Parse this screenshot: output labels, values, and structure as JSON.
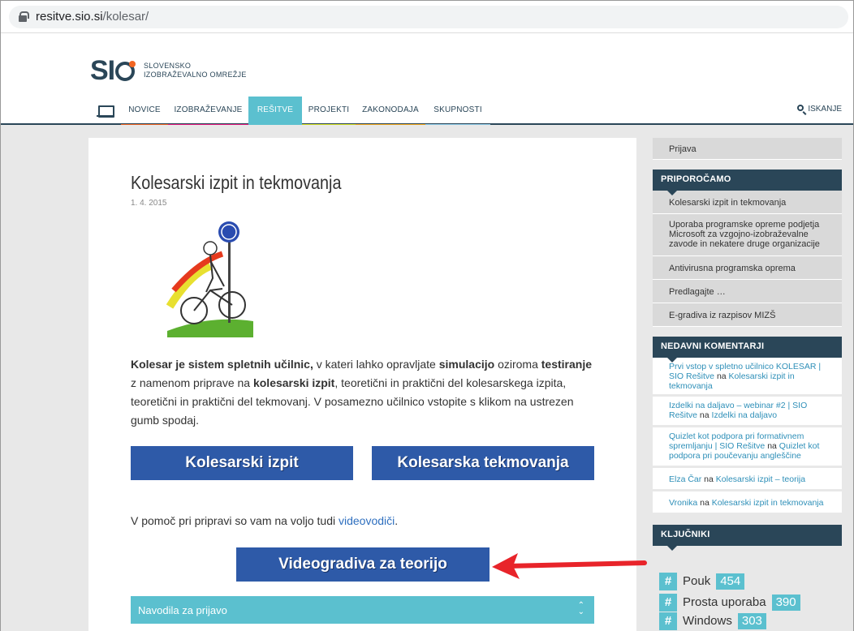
{
  "browser": {
    "url_host": "resitve.sio.si",
    "url_path": "/kolesar/"
  },
  "logo": {
    "mark": "SI",
    "line1": "SLOVENSKO",
    "line2": "IZOBRAŽEVALNO OMREŽJE"
  },
  "nav": {
    "items": [
      {
        "label": "NOVICE",
        "color": "#f26522"
      },
      {
        "label": "IZOBRAŽEVANJE",
        "color": "#e6197e"
      },
      {
        "label": "REŠITVE",
        "color": "#5bc0cf"
      },
      {
        "label": "PROJEKTI",
        "color": "#d4e021"
      },
      {
        "label": "ZAKONODAJA",
        "color": "#f2a81d"
      },
      {
        "label": "SKUPNOSTI",
        "color": "#8fcbe6"
      }
    ],
    "search_label": "ISKANJE"
  },
  "article": {
    "title": "Kolesarski izpit in tekmovanja",
    "date": "1. 4. 2015",
    "intro": [
      {
        "b": "Kolesar je sistem spletnih učilnic,"
      },
      {
        "t": " v kateri lahko opravljate "
      },
      {
        "b": "simulacijo"
      },
      {
        "t": " oziroma "
      },
      {
        "b": "testiranje"
      },
      {
        "t": " z namenom priprave na "
      },
      {
        "b": "kolesarski izpit"
      },
      {
        "t": ", teoretični in praktični del kolesarskega izpita, teoretični in praktični del tekmovanj. V posamezno učilnico vstopite s klikom na ustrezen gumb spodaj."
      }
    ],
    "btn1": "Kolesarski izpit",
    "btn2": "Kolesarska tekmovanja",
    "help_text": "V pomoč pri pripravi so vam na voljo tudi ",
    "help_link": "videovodiči",
    "help_end": ".",
    "btn3": "Videogradiva za teorijo",
    "accordion": "Navodila za prijavo"
  },
  "sidebar": {
    "login": "Prijava",
    "recommend_title": "PRIPOROČAMO",
    "recommend": [
      "Kolesarski izpit in tekmovanja",
      "Uporaba programske opreme podjetja Microsoft za vzgojno-izobraževalne zavode in nekatere druge organizacije",
      "Antivirusna programska oprema",
      "Predlagajte …",
      "E-gradiva iz razpisov MIZŠ"
    ],
    "comments_title": "NEDAVNI KOMENTARJI",
    "comments": [
      {
        "author": "Prvi vstop v spletno učilnico KOLESAR | SIO Rešitve",
        "on": " na ",
        "post": "Kolesarski izpit in tekmovanja"
      },
      {
        "author": "Izdelki na daljavo – webinar #2 | SIO Rešitve",
        "on": " na ",
        "post": "Izdelki na daljavo"
      },
      {
        "author": "Quizlet kot podpora pri formativnem spremljanju | SIO Rešitve",
        "on": " na ",
        "post": "Quizlet kot podpora pri poučevanju angleščine"
      },
      {
        "author": "Elza Čar",
        "on": " na ",
        "post": "Kolesarski izpit – teorija"
      },
      {
        "author": "Vronika",
        "on": " na ",
        "post": "Kolesarski izpit in tekmovanja"
      }
    ],
    "tags_title": "KLJUČNIKI",
    "tags": [
      {
        "name": "Pouk",
        "count": "454"
      },
      {
        "name": "Prosta uporaba",
        "count": "390"
      },
      {
        "name": "Windows",
        "count": "303"
      }
    ]
  }
}
